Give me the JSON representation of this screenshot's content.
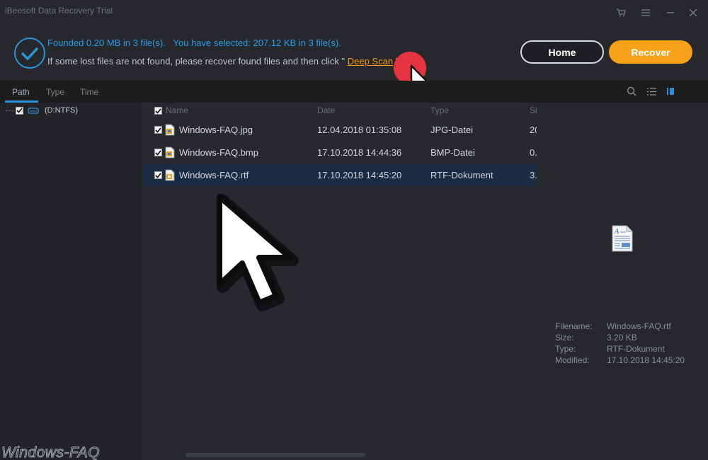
{
  "window": {
    "title": "iBeesoft Data Recovery Trial",
    "controls": [
      "cart-icon",
      "menu-icon",
      "minimize-icon",
      "close-icon"
    ]
  },
  "banner": {
    "status_line1": "Founded 0.20 MB in 3 file(s).   You have selected: 207.12 KB in 3 file(s).",
    "status_line2_prefix": "If some lost files are not found, please recover found files and then click \" ",
    "deep_scan_link": "Deep Scan",
    "status_line2_suffix": " \"",
    "home_button": "Home",
    "recover_button": "Recover"
  },
  "colors": {
    "accent_blue": "#2a9be6",
    "accent_orange": "#f7a11b",
    "selection": "#1a2c42"
  },
  "tabs": [
    "Path",
    "Type",
    "Time"
  ],
  "active_tab": "Path",
  "tree": {
    "drive": "(D:NTFS)"
  },
  "file_list": {
    "columns": [
      "Name",
      "Date",
      "Type",
      "Si"
    ],
    "rows": [
      {
        "name": "Windows-FAQ.jpg",
        "date": "12.04.2018 01:35:08",
        "type": "JPG-Datei",
        "size": "20"
      },
      {
        "name": "Windows-FAQ.bmp",
        "date": "17.10.2018 14:44:36",
        "type": "BMP-Datei",
        "size": "0."
      },
      {
        "name": "Windows-FAQ.rtf",
        "date": "17.10.2018 14:45:20",
        "type": "RTF-Dokument",
        "size": "3."
      }
    ],
    "selected_row": 2
  },
  "preview": {
    "labels": {
      "filename": "Filename:",
      "size": "Size:",
      "type": "Type:",
      "modified": "Modified:"
    },
    "filename": "Windows-FAQ.rtf",
    "size": "3.20 KB",
    "type": "RTF-Dokument",
    "modified": "17.10.2018 14:45:20"
  },
  "watermark": "Windows-FAQ"
}
